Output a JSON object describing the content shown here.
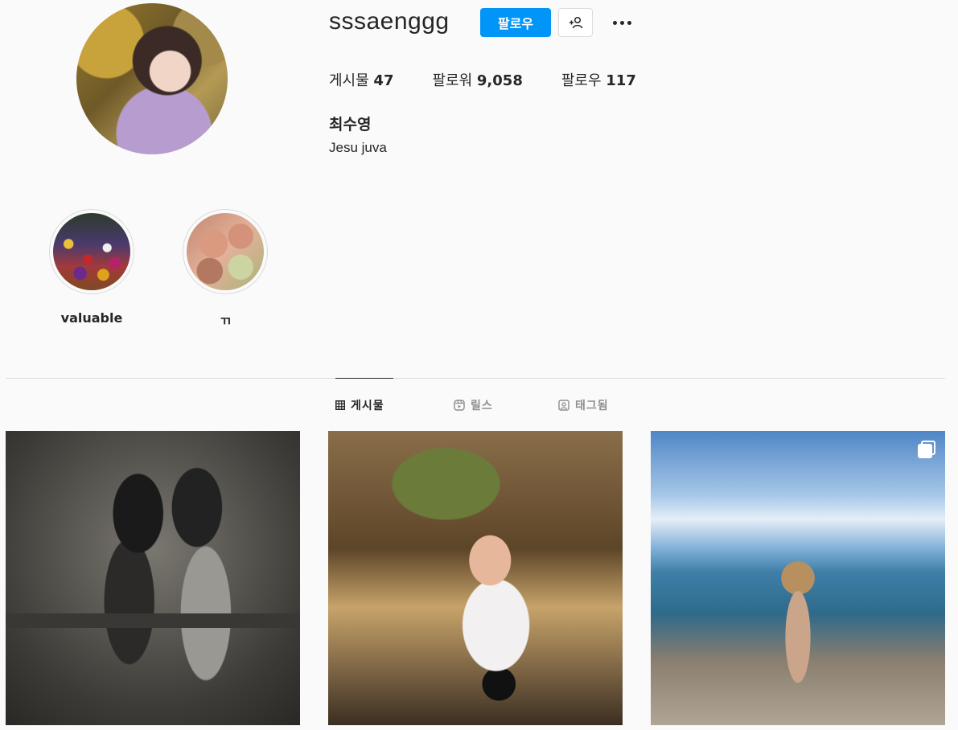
{
  "profile": {
    "username": "sssaenggg",
    "follow_label": "팔로우",
    "full_name": "최수영",
    "bio": "Jesu juva"
  },
  "stats": {
    "posts": {
      "label": "게시물",
      "value": "47"
    },
    "followers": {
      "label": "팔로워",
      "value": "9,058"
    },
    "following": {
      "label": "팔로우",
      "value": "117"
    }
  },
  "icons": {
    "suggest": "add-person-icon",
    "more": "more-options-icon",
    "multi_photo": "carousel-icon"
  },
  "highlights": [
    {
      "label": "valuable"
    },
    {
      "label": "ㄲ"
    }
  ],
  "tabs": [
    {
      "label": "게시물",
      "icon": "grid-icon",
      "active": true
    },
    {
      "label": "릴스",
      "icon": "reels-icon",
      "active": false
    },
    {
      "label": "태그됨",
      "icon": "tagged-icon",
      "active": false
    }
  ],
  "colors": {
    "accent": "#0095f6",
    "text": "#262626",
    "muted": "#8e8e8e",
    "border": "#dbdbdb",
    "background": "#fafafa"
  }
}
